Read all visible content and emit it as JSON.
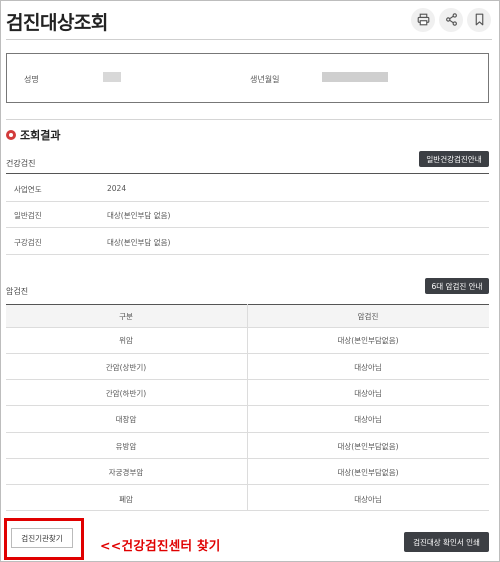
{
  "page": {
    "title": "검진대상조회"
  },
  "toolbar": {
    "icons": [
      "printer-icon",
      "share-icon",
      "bookmark-icon"
    ]
  },
  "profile": {
    "name_label": "성명",
    "birth_label": "생년월일"
  },
  "result": {
    "section_title": "조회결과",
    "general": {
      "title": "건강검진",
      "button": "일반건강검진안내",
      "rows": [
        {
          "label": "사업연도",
          "value": "2024"
        },
        {
          "label": "일반검진",
          "value": "대상(본인부담 없음)"
        },
        {
          "label": "구강검진",
          "value": "대상(본인부담 없음)"
        }
      ]
    },
    "cancer": {
      "title": "암검진",
      "button": "6대 암검진 안내",
      "headers": [
        "구분",
        "암검진"
      ],
      "rows": [
        {
          "type": "위암",
          "status": "대상(본인부담없음)"
        },
        {
          "type": "간암(상반기)",
          "status": "대상아님"
        },
        {
          "type": "간암(하반기)",
          "status": "대상아님"
        },
        {
          "type": "대장암",
          "status": "대상아님"
        },
        {
          "type": "유방암",
          "status": "대상(본인부담없음)"
        },
        {
          "type": "자궁경부암",
          "status": "대상(본인부담없음)"
        },
        {
          "type": "폐암",
          "status": "대상아님"
        }
      ]
    }
  },
  "footer": {
    "find_button": "검진기관찾기",
    "annotation": "<<건강검진센터 찾기",
    "confirm_button": "검진대상 확인서 인쇄"
  },
  "colors": {
    "accent_red": "#e00000",
    "dark_button": "#3c3f44"
  }
}
